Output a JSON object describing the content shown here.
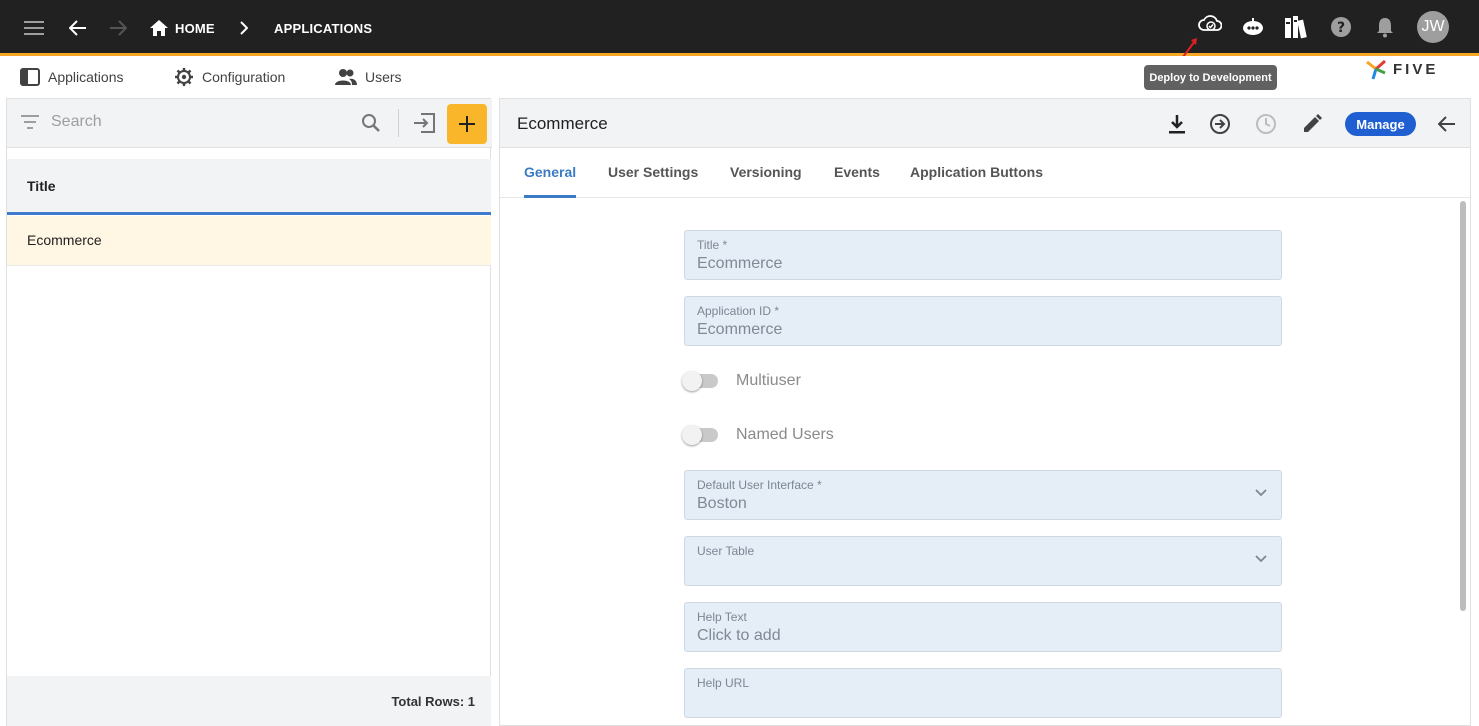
{
  "topbar": {
    "breadcrumb": {
      "home": "HOME",
      "applications": "APPLICATIONS"
    },
    "avatar_initials": "JW",
    "accent": "#f5a623",
    "icons": [
      "menu-icon",
      "back-arrow-icon",
      "forward-arrow-icon",
      "home-icon",
      "chevron-right-icon",
      "cloud-deploy-icon",
      "chatbot-icon",
      "library-icon",
      "help-icon",
      "bell-icon"
    ]
  },
  "tooltip": {
    "text": "Deploy to Development"
  },
  "menubar": {
    "items": [
      {
        "label": "Applications",
        "icon": "panel-icon"
      },
      {
        "label": "Configuration",
        "icon": "gear-icon"
      },
      {
        "label": "Users",
        "icon": "users-icon"
      }
    ],
    "logo_text": "FIVE"
  },
  "left_panel": {
    "search_placeholder": "Search",
    "column_header": "Title",
    "rows": [
      {
        "title": "Ecommerce"
      }
    ],
    "footer": "Total Rows: 1",
    "add_button_color": "#f9b62a"
  },
  "right_panel": {
    "title": "Ecommerce",
    "manage_label": "Manage",
    "tabs": [
      "General",
      "User Settings",
      "Versioning",
      "Events",
      "Application Buttons"
    ],
    "active_tab": "General",
    "form": {
      "title": {
        "label": "Title *",
        "value": "Ecommerce"
      },
      "app_id": {
        "label": "Application ID *",
        "value": "Ecommerce"
      },
      "multiuser": {
        "label": "Multiuser",
        "checked": false
      },
      "named_users": {
        "label": "Named Users",
        "checked": false
      },
      "default_ui": {
        "label": "Default User Interface *",
        "value": "Boston"
      },
      "user_table": {
        "label": "User Table",
        "value": ""
      },
      "help_text": {
        "label": "Help Text",
        "value": "Click to add"
      },
      "help_url": {
        "label": "Help URL",
        "value": ""
      }
    }
  }
}
